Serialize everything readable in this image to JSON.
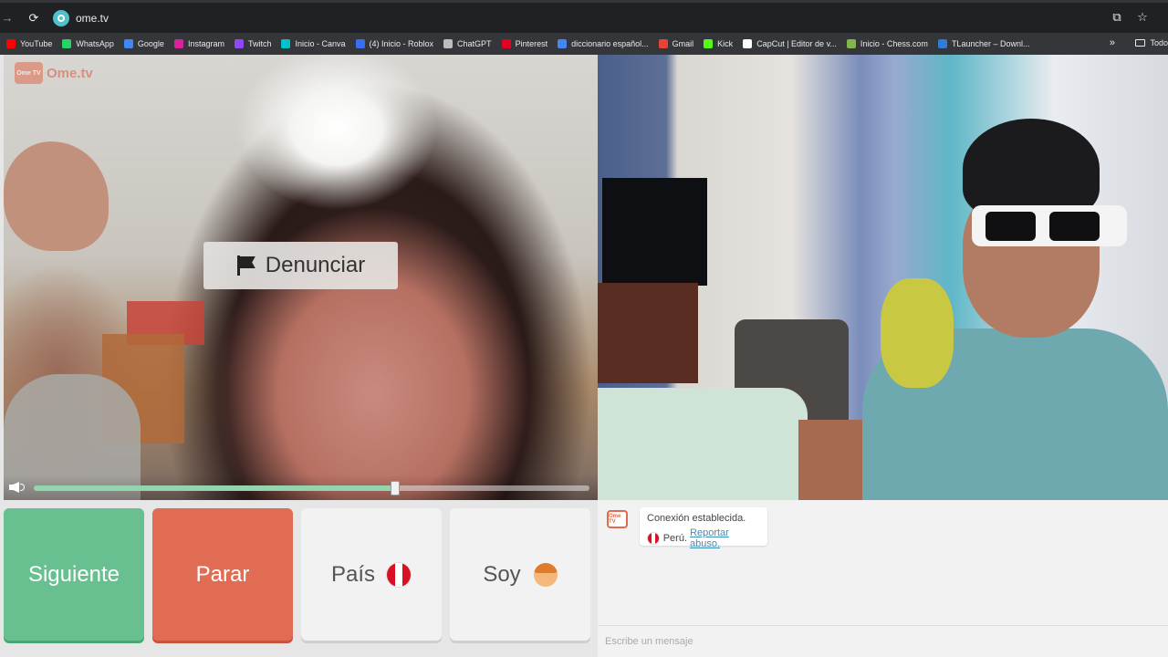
{
  "browser": {
    "url": "ome.tv",
    "bookmarks": [
      {
        "label": "YouTube",
        "icon": "youtube-icon",
        "color": "#ff0000"
      },
      {
        "label": "WhatsApp",
        "icon": "whatsapp-icon",
        "color": "#25d366"
      },
      {
        "label": "Google",
        "icon": "google-icon",
        "color": "#4285f4"
      },
      {
        "label": "Instagram",
        "icon": "instagram-icon",
        "color": "#d6249f"
      },
      {
        "label": "Twitch",
        "icon": "twitch-icon",
        "color": "#9146ff"
      },
      {
        "label": "Inicio - Canva",
        "icon": "canva-icon",
        "color": "#00c4cc"
      },
      {
        "label": "(4) Inicio - Roblox",
        "icon": "roblox-icon",
        "color": "#3a6df0"
      },
      {
        "label": "ChatGPT",
        "icon": "chatgpt-icon",
        "color": "#bdbdbd"
      },
      {
        "label": "Pinterest",
        "icon": "pinterest-icon",
        "color": "#e60023"
      },
      {
        "label": "diccionario español...",
        "icon": "google-icon",
        "color": "#4285f4"
      },
      {
        "label": "Gmail",
        "icon": "gmail-icon",
        "color": "#ea4335"
      },
      {
        "label": "Kick",
        "icon": "kick-icon",
        "color": "#53fc18"
      },
      {
        "label": "CapCut | Editor de v...",
        "icon": "capcut-icon",
        "color": "#ffffff"
      },
      {
        "label": "Inicio - Chess.com",
        "icon": "chess-icon",
        "color": "#81b64c"
      },
      {
        "label": "TLauncher – Downl...",
        "icon": "tlauncher-icon",
        "color": "#2e7cd6"
      }
    ],
    "folder_label": "Todo"
  },
  "left_video": {
    "logo_text": "Ome.tv",
    "logo_badge": "Ome TV",
    "report_label": "Denunciar",
    "volume_level": 0.65
  },
  "controls": {
    "next_label": "Siguiente",
    "stop_label": "Parar",
    "country_label": "País",
    "gender_label": "Soy"
  },
  "chat": {
    "logo_badge": "Ome TV",
    "status_text": "Conexión establecida.",
    "country_text": "Perú.",
    "report_link": "Reportar abuso.",
    "input_placeholder": "Escribe un mensaje"
  },
  "colors": {
    "next": "#68bf8f",
    "stop": "#e06c53",
    "peru_red": "#d91023",
    "slider_fill": "#93d3ad"
  }
}
